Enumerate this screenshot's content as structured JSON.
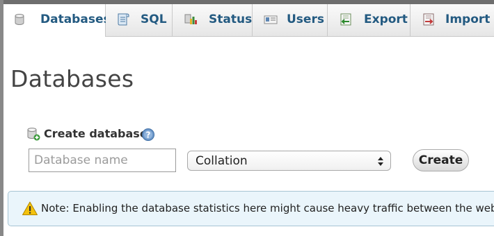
{
  "tabs": [
    {
      "label": "Databases",
      "icon": "database-icon",
      "active": true
    },
    {
      "label": "SQL",
      "icon": "sql-icon",
      "active": false
    },
    {
      "label": "Status",
      "icon": "status-icon",
      "active": false
    },
    {
      "label": "Users",
      "icon": "users-icon",
      "active": false
    },
    {
      "label": "Export",
      "icon": "export-icon",
      "active": false
    },
    {
      "label": "Import",
      "icon": "import-icon",
      "active": false
    }
  ],
  "page": {
    "title": "Databases"
  },
  "create_database": {
    "heading": "Create database",
    "name_placeholder": "Database name",
    "name_value": "",
    "collation_value": "Collation",
    "create_label": "Create"
  },
  "notice": {
    "text": "Note: Enabling the database statistics here might cause heavy traffic between the web"
  },
  "colors": {
    "tab_text": "#235a81",
    "notice_bg": "#eaf5fb",
    "notice_border": "#a6c4d3"
  }
}
